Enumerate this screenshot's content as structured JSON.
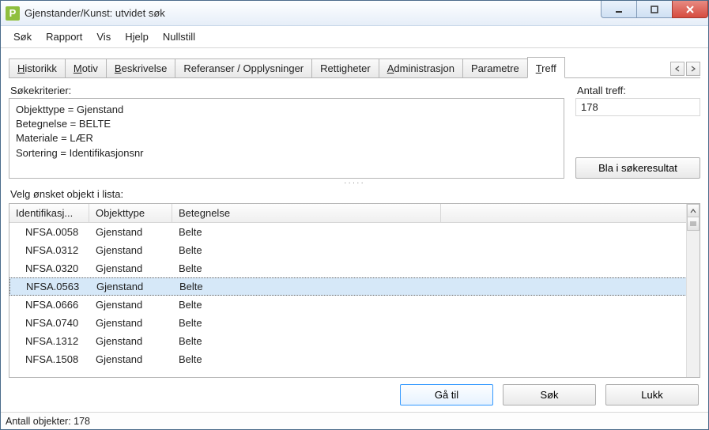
{
  "window": {
    "title": "Gjenstander/Kunst: utvidet søk",
    "app_icon_letter": "P"
  },
  "menu": {
    "items": [
      "Søk",
      "Rapport",
      "Vis",
      "Hjelp",
      "Nullstill"
    ]
  },
  "tabs": {
    "items": [
      {
        "label": "Historikk",
        "ul": "H"
      },
      {
        "label": "Motiv",
        "ul": "M"
      },
      {
        "label": "Beskrivelse",
        "ul": "B"
      },
      {
        "label": "Referanser / Opplysninger",
        "ul": ""
      },
      {
        "label": "Rettigheter",
        "ul": ""
      },
      {
        "label": "Administrasjon",
        "ul": "A"
      },
      {
        "label": "Parametre",
        "ul": ""
      },
      {
        "label": "Treff",
        "ul": "T"
      }
    ],
    "active_index": 7
  },
  "criteria": {
    "label": "Søkekriterier:",
    "lines": [
      "Objekttype = Gjenstand",
      "Betegnelse = BELTE",
      "Materiale = LÆR",
      "Sortering = Identifikasjonsnr"
    ]
  },
  "count": {
    "label": "Antall treff:",
    "value": "178"
  },
  "browse_button": "Bla i søkeresultat",
  "list_label": "Velg ønsket objekt i lista:",
  "columns": {
    "c1": "Identifikasj...",
    "c2": "Objekttype",
    "c3": "Betegnelse"
  },
  "rows": [
    {
      "id": "NFSA.0058",
      "type": "Gjenstand",
      "name": "Belte",
      "selected": false
    },
    {
      "id": "NFSA.0312",
      "type": "Gjenstand",
      "name": "Belte",
      "selected": false
    },
    {
      "id": "NFSA.0320",
      "type": "Gjenstand",
      "name": "Belte",
      "selected": false
    },
    {
      "id": "NFSA.0563",
      "type": "Gjenstand",
      "name": "Belte",
      "selected": true
    },
    {
      "id": "NFSA.0666",
      "type": "Gjenstand",
      "name": "Belte",
      "selected": false
    },
    {
      "id": "NFSA.0740",
      "type": "Gjenstand",
      "name": "Belte",
      "selected": false
    },
    {
      "id": "NFSA.1312",
      "type": "Gjenstand",
      "name": "Belte",
      "selected": false
    },
    {
      "id": "NFSA.1508",
      "type": "Gjenstand",
      "name": "Belte",
      "selected": false
    }
  ],
  "footer": {
    "go_to": "Gå til",
    "search": "Søk",
    "close": "Lukk"
  },
  "status": {
    "text": "Antall objekter: 178"
  }
}
